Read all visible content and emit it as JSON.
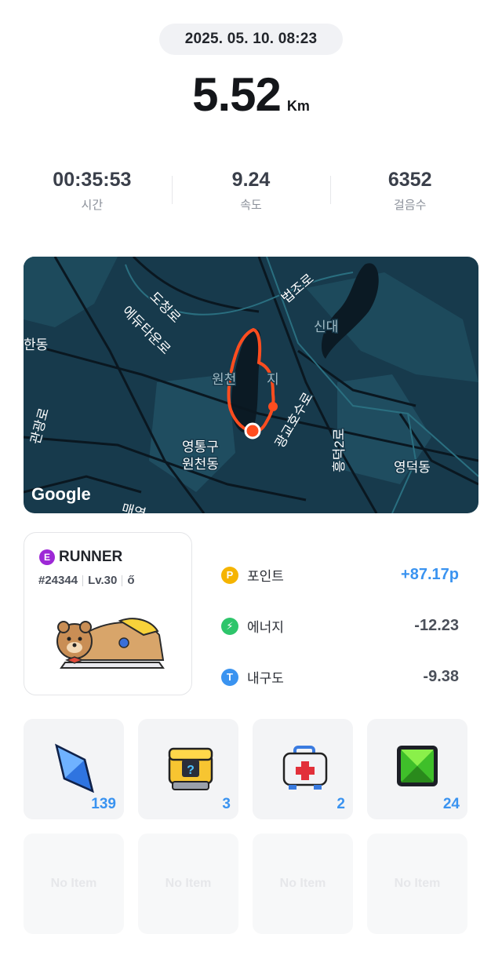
{
  "datetime": "2025. 05. 10. 08:23",
  "distance": {
    "value": "5.52",
    "unit": "Km"
  },
  "stats": [
    {
      "value": "00:35:53",
      "label": "시간"
    },
    {
      "value": "9.24",
      "label": "속도"
    },
    {
      "value": "6352",
      "label": "걸음수"
    }
  ],
  "map": {
    "attribution": "Google",
    "labels": [
      "에듀타운로",
      "도청로",
      "법조로",
      "신대",
      "원천",
      "지",
      "광교호수로",
      "흥덕2로",
      "영통구",
      "원천동",
      "영덕동",
      "관광로",
      "한동",
      "매영"
    ],
    "route_color": "#ff4d1f"
  },
  "runner": {
    "grade": "E",
    "type": "RUNNER",
    "id": "#24344",
    "level": "Lv.30",
    "extra_icon": "gender-icon",
    "grade_color": "#9d28d6"
  },
  "rewards": [
    {
      "label": "포인트",
      "value": "+87.17p",
      "icon": "P",
      "icon_color": "#f5b400",
      "value_color": "#3a93f0"
    },
    {
      "label": "에너지",
      "value": "-12.23",
      "icon": "⚡",
      "icon_color": "#2ec56b",
      "value_color": "#4b505a"
    },
    {
      "label": "내구도",
      "value": "-9.38",
      "icon": "T",
      "icon_color": "#3a93f0",
      "value_color": "#4b505a"
    }
  ],
  "items": [
    {
      "name": "blue-crystal",
      "count": "139"
    },
    {
      "name": "mystery-box",
      "count": "3"
    },
    {
      "name": "repair-kit",
      "count": "2"
    },
    {
      "name": "green-gem",
      "count": "24"
    }
  ],
  "empty_items": [
    "No Item",
    "No Item",
    "No Item",
    "No Item"
  ]
}
